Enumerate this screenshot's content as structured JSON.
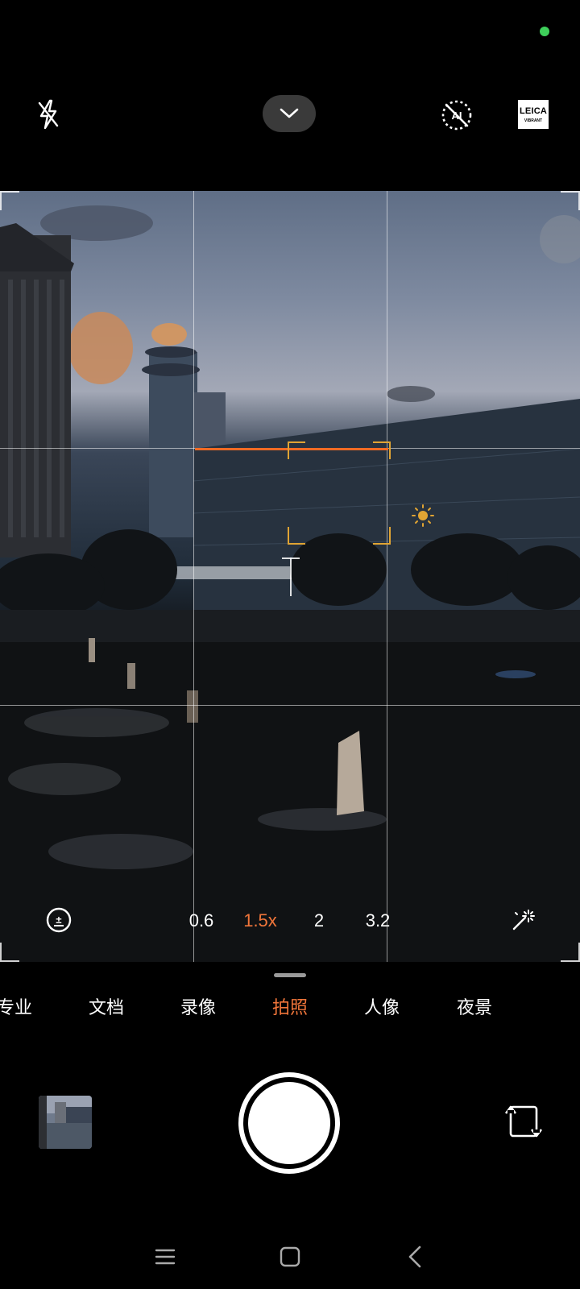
{
  "status": {
    "indicator_color": "#3ecf5a"
  },
  "top_bar": {
    "flash_icon": "flash-off-icon",
    "more_icon": "chevron-down-icon",
    "ai_icon": "ai-scene-off-icon",
    "leica": {
      "line1": "LEICA",
      "line2": "VIBRANT"
    }
  },
  "viewfinder": {
    "focus_color": "#e0a433",
    "accent": "#f06a24",
    "zoom_levels": [
      {
        "label": "0.6",
        "active": false
      },
      {
        "label": "1.5x",
        "active": true
      },
      {
        "label": "2",
        "active": false
      },
      {
        "label": "3.2",
        "active": false
      }
    ]
  },
  "modes": [
    {
      "label": "专业",
      "active": false
    },
    {
      "label": "文档",
      "active": false
    },
    {
      "label": "录像",
      "active": false
    },
    {
      "label": "拍照",
      "active": true
    },
    {
      "label": "人像",
      "active": false
    },
    {
      "label": "夜景",
      "active": false
    }
  ],
  "nav": {
    "menu_icon": "menu-icon",
    "home_icon": "home-icon",
    "back_icon": "back-icon"
  }
}
